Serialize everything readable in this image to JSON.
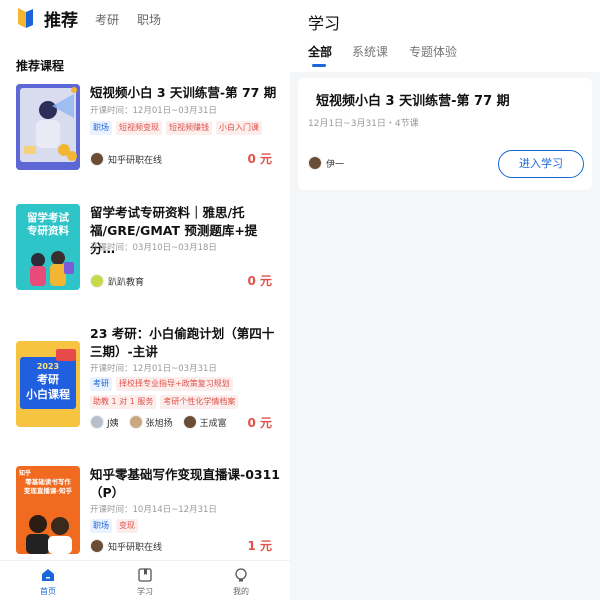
{
  "left": {
    "tabs": [
      {
        "label": "推荐"
      },
      {
        "label": "考研"
      },
      {
        "label": "职场"
      }
    ],
    "section_title": "推荐课程",
    "courses": [
      {
        "title": "短视频小白 3 天训练营-第 77 期",
        "time": "开课时间：12月01日~03月31日",
        "tags": [
          {
            "label": "职场",
            "style": "blue"
          },
          {
            "label": "短视频变现",
            "style": "red"
          },
          {
            "label": "短视频赚钱",
            "style": "red"
          },
          {
            "label": "小白入门课",
            "style": "red"
          }
        ],
        "provider": "知乎研职在线",
        "price": "0 元"
      },
      {
        "title": "留学考试专研资料｜雅思/托福/GRE/GMAT 预测题库+提分…",
        "thumb_text": [
          "留学考试",
          "专研资料"
        ],
        "time": "开课时间：03月10日~03月18日",
        "tags": [],
        "provider": "趴趴教育",
        "price": "0 元"
      },
      {
        "title": "23 考研：小白偷跑计划（第四十三期）-主讲",
        "thumb_text": [
          "2023",
          "考研",
          "小白课程"
        ],
        "time": "开课时间：12月01日~03月31日",
        "tags": [
          {
            "label": "考研",
            "style": "blue"
          },
          {
            "label": "择校择专业指导+政策复习规划",
            "style": "red"
          },
          {
            "label": "助教 1 对 1 服务",
            "style": "red"
          },
          {
            "label": "考研个性化学情档案",
            "style": "red"
          }
        ],
        "teachers": [
          "J姨",
          "张旭扬",
          "王成富"
        ],
        "price": "0 元"
      },
      {
        "title": "知乎零基础写作变现直播课-0311（P）",
        "thumb_text": [
          "知乎",
          "零基础读书写作",
          "变现直播课-知乎"
        ],
        "time": "开课时间：10月14日~12月31日",
        "tags": [
          {
            "label": "职场",
            "style": "blue"
          },
          {
            "label": "变现",
            "style": "red"
          }
        ],
        "provider": "知乎研职在线",
        "price": "1 元"
      }
    ],
    "bottom_nav": [
      {
        "label": "首页"
      },
      {
        "label": "学习"
      },
      {
        "label": "我的"
      }
    ],
    "colors": {
      "accent": "#1a66d9",
      "price": "#e0524a"
    }
  },
  "right": {
    "title": "学习",
    "tabs": [
      {
        "label": "全部"
      },
      {
        "label": "系统课"
      },
      {
        "label": "专题体验"
      }
    ],
    "card": {
      "title": "短视频小白 3 天训练营-第 77 期",
      "meta": "12月1日~3月31日・4节课",
      "user": "伊一",
      "button": "进入学习"
    }
  }
}
